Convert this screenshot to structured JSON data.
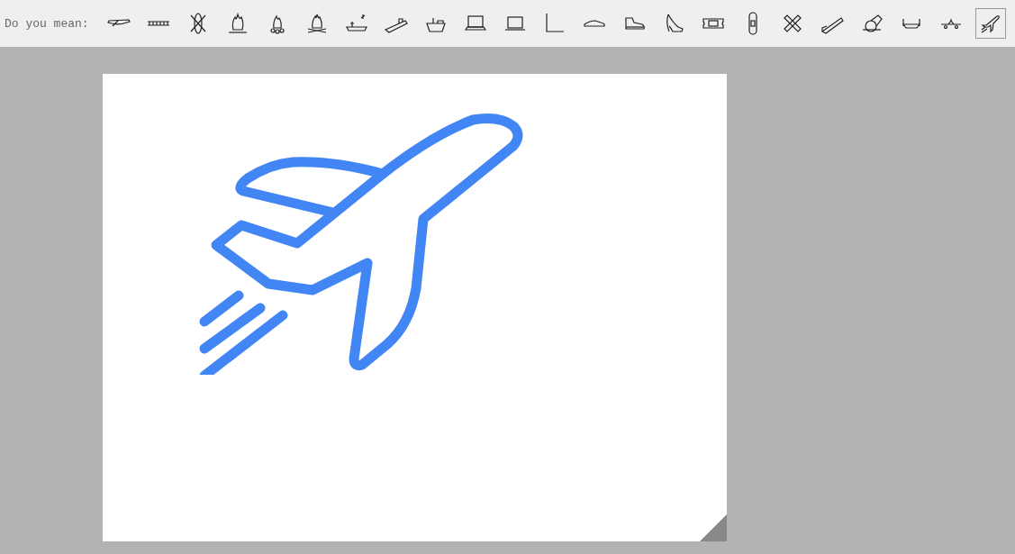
{
  "suggestion_bar": {
    "prompt": "Do you mean:",
    "suggestions": [
      {
        "selected": false
      },
      {
        "selected": false
      },
      {
        "selected": false
      },
      {
        "selected": false
      },
      {
        "selected": false
      },
      {
        "selected": false
      },
      {
        "selected": false
      },
      {
        "selected": false
      },
      {
        "selected": false
      },
      {
        "selected": false
      },
      {
        "selected": false
      },
      {
        "selected": false
      },
      {
        "selected": false
      },
      {
        "selected": false
      },
      {
        "selected": false
      },
      {
        "selected": false
      },
      {
        "selected": false
      },
      {
        "selected": false
      },
      {
        "selected": false
      },
      {
        "selected": false
      },
      {
        "selected": false
      },
      {
        "selected": false
      },
      {
        "selected": true
      }
    ]
  }
}
